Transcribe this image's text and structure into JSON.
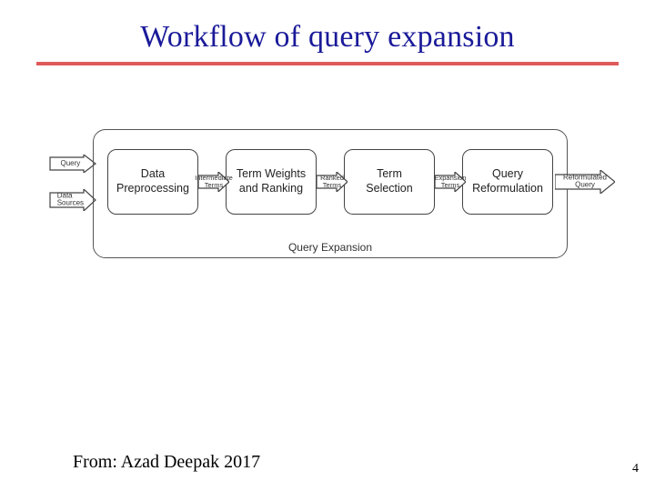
{
  "title": "Workflow of query expansion",
  "input_arrows": {
    "top": "Query",
    "bottom_line1": "Data",
    "bottom_line2": "Sources"
  },
  "stages": {
    "s1_line1": "Data",
    "s1_line2": "Preprocessing",
    "s2_line1": "Term Weights",
    "s2_line2": "and Ranking",
    "s3_line1": "Term",
    "s3_line2": "Selection",
    "s4_line1": "Query",
    "s4_line2": "Reformulation"
  },
  "connector_labels": {
    "c12_line1": "Intermediate",
    "c12_line2": "Terms",
    "c23_line1": "Ranked",
    "c23_line2": "Terms",
    "c34_line1": "Expansion",
    "c34_line2": "Terms",
    "out_line1": "Reformulated",
    "out_line2": "Query"
  },
  "container_label": "Query Expansion",
  "citation": "From:  Azad   Deepak  2017",
  "page_number": "4"
}
